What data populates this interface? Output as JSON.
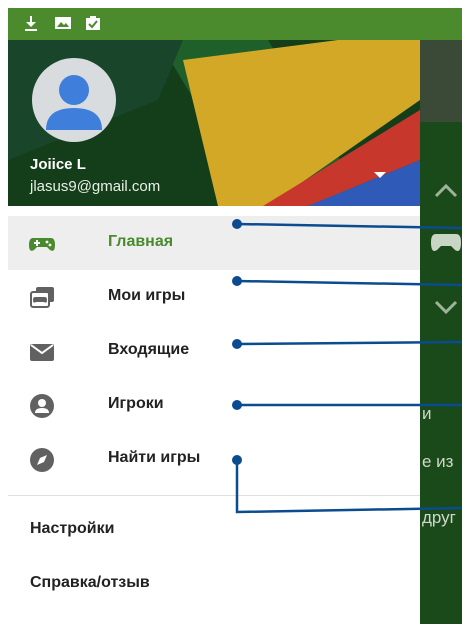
{
  "account": {
    "name": "Joiice L",
    "email": "jlasus9@gmail.com"
  },
  "nav": {
    "items": [
      {
        "label": "Главная",
        "icon": "gamepad-icon",
        "active": true
      },
      {
        "label": "Мои игры",
        "icon": "my-games-icon",
        "active": false
      },
      {
        "label": "Входящие",
        "icon": "inbox-icon",
        "active": false
      },
      {
        "label": "Игроки",
        "icon": "players-icon",
        "active": false
      },
      {
        "label": "Найти игры",
        "icon": "compass-icon",
        "active": false
      }
    ]
  },
  "secondary": {
    "settings_label": "Настройки",
    "help_label": "Справка/отзыв"
  },
  "background_app": {
    "fragment_1": "и",
    "fragment_2": "е из",
    "fragment_3": "друг"
  },
  "colors": {
    "accent_green": "#4a8a2f",
    "status_bar": "#4c8a2e",
    "callout_line": "#0b4b8f"
  }
}
